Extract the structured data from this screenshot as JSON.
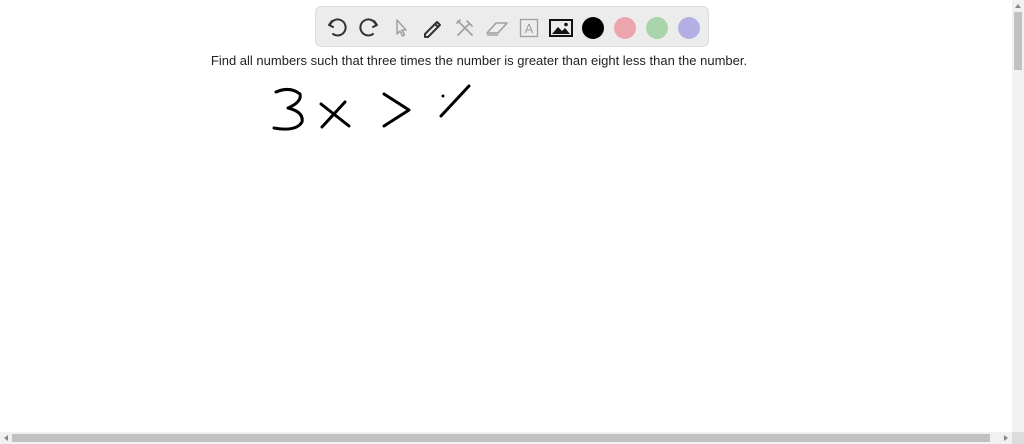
{
  "toolbar": {
    "tools": [
      {
        "name": "undo-icon"
      },
      {
        "name": "redo-icon"
      },
      {
        "name": "pointer-icon"
      },
      {
        "name": "pen-icon"
      },
      {
        "name": "tools-icon"
      },
      {
        "name": "eraser-icon"
      },
      {
        "name": "text-icon",
        "glyph": "A"
      },
      {
        "name": "image-icon"
      }
    ],
    "colors": [
      "#000000",
      "#eba6ad",
      "#a9d4a9",
      "#b4b0e6"
    ]
  },
  "problem": {
    "text": "Find all numbers such that three times the number is greater than eight less than the number."
  },
  "ink_color": "#000000"
}
